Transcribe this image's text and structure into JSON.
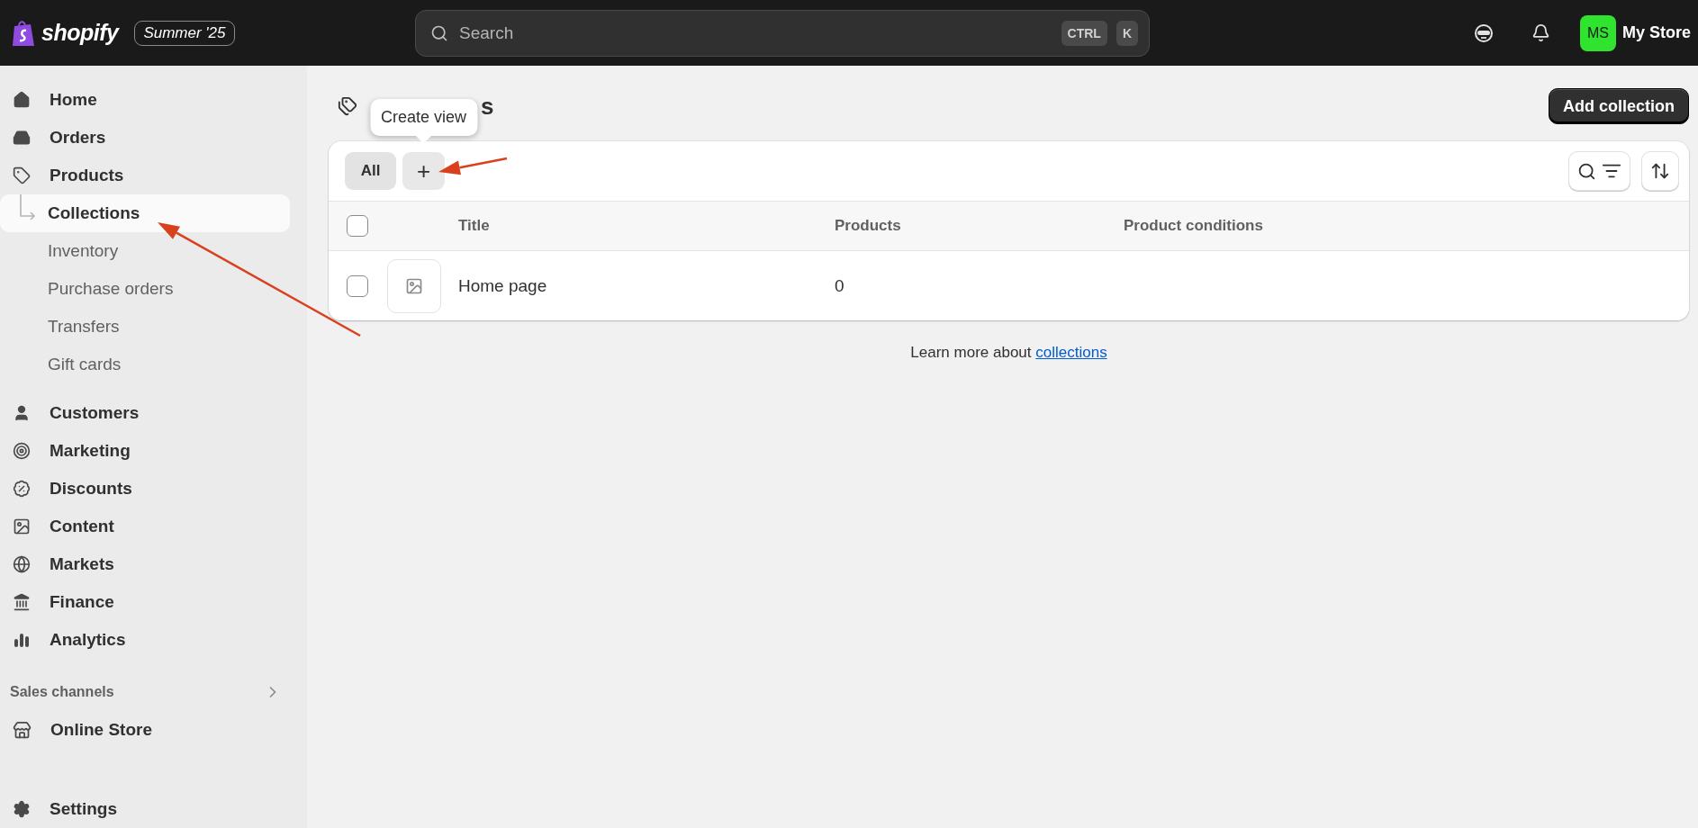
{
  "top_bar": {
    "logo": "shopify",
    "edition": "Summer '25",
    "search": {
      "placeholder": "Search",
      "keys": [
        "CTRL",
        "K"
      ]
    },
    "store": {
      "initials": "MS",
      "name": "My Store"
    }
  },
  "sidebar": {
    "items": [
      {
        "label": "Home",
        "selected": false
      },
      {
        "label": "Orders",
        "selected": false
      },
      {
        "label": "Products",
        "selected": false,
        "children": [
          {
            "label": "Collections",
            "selected": true
          },
          {
            "label": "Inventory",
            "selected": false
          },
          {
            "label": "Purchase orders",
            "selected": false
          },
          {
            "label": "Transfers",
            "selected": false
          },
          {
            "label": "Gift cards",
            "selected": false
          }
        ]
      },
      {
        "label": "Customers",
        "selected": false
      },
      {
        "label": "Marketing",
        "selected": false
      },
      {
        "label": "Discounts",
        "selected": false
      },
      {
        "label": "Content",
        "selected": false
      },
      {
        "label": "Markets",
        "selected": false
      },
      {
        "label": "Finance",
        "selected": false
      },
      {
        "label": "Analytics",
        "selected": false
      }
    ],
    "sales_channels": {
      "title": "Sales channels",
      "items": [
        {
          "label": "Online Store",
          "selected": false
        }
      ]
    },
    "settings": {
      "label": "Settings"
    }
  },
  "page": {
    "title": "s",
    "primary_action": "Add collection",
    "tooltip": "Create view",
    "views": [
      {
        "label": "All",
        "selected": true
      }
    ],
    "add_view": "+",
    "table": {
      "columns": [
        "Title",
        "Products",
        "Product conditions"
      ],
      "header_checked": false,
      "rows": [
        {
          "title": "Home page",
          "products": "0",
          "checked": false
        }
      ]
    },
    "footer": {
      "text": "Learn more about",
      "link": "collections"
    }
  }
}
